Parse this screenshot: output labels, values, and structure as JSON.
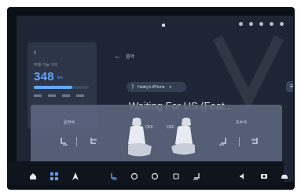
{
  "status_bar": {
    "icons": [
      "nav-arrow-icon",
      "signal-icon",
      "dot-icon",
      "bluetooth-icon",
      "wifi-icon",
      "battery-icon"
    ]
  },
  "left_card": {
    "range_label": "주행 가능 거리",
    "range_value": "348",
    "range_unit": "km",
    "range_fill_percent": 70
  },
  "header": {
    "title": "음악"
  },
  "bluetooth": {
    "device_name": "Hailey's iPhone"
  },
  "player": {
    "track_title": "Waiting For US (Feat..."
  },
  "seat_panel": {
    "driver_label": "운전석",
    "passenger_label": "조수석",
    "left_seat_status": "OFF",
    "right_seat_status": "OFF"
  },
  "bottom_bar": {
    "items": [
      "home-icon",
      "apps-grid-icon",
      "navigation-icon",
      "seat-heat-icon",
      "fan-left-icon",
      "fan-right-icon",
      "defrost-icon",
      "seat-heat-right-icon",
      "volume-icon",
      "camera-icon",
      "car-icon"
    ]
  },
  "colors": {
    "accent": "#66a6ff",
    "background": "#1e2636",
    "panel": "#5c6880"
  }
}
